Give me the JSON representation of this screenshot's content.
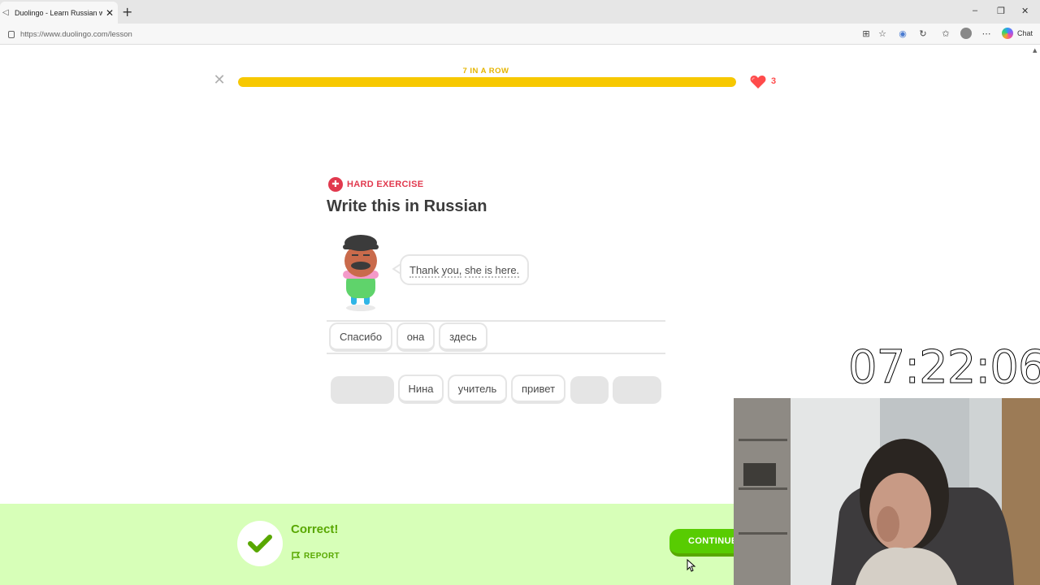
{
  "browser": {
    "tab_title": "Duolingo - Learn Russian with",
    "tab_close": "✕",
    "new_tab": "+",
    "url": "https://www.duolingo.com/lesson",
    "chat_label": "Chat",
    "window_controls": {
      "minimize": "–",
      "restore": "❐",
      "close": "✕"
    }
  },
  "lesson": {
    "close_glyph": "✕",
    "streak_label": "7 IN A ROW",
    "progress": 1.0,
    "hearts": "3",
    "colors": {
      "progress": "#f7c800",
      "heart": "#ff4b4b",
      "accent_green": "#58cc02"
    }
  },
  "exercise": {
    "badge_label": "HARD EXERCISE",
    "title": "Write this in Russian",
    "prompt_words": [
      "Thank you,",
      "she is here."
    ],
    "answer_chips": [
      "Спасибо",
      "она",
      "здесь"
    ],
    "bank_chips": [
      "Нина",
      "учитель",
      "привет"
    ]
  },
  "overlay": {
    "timer": "07:22:06"
  },
  "footer": {
    "result": "Correct!",
    "report_label": "REPORT",
    "continue_label": "CONTINUE"
  }
}
